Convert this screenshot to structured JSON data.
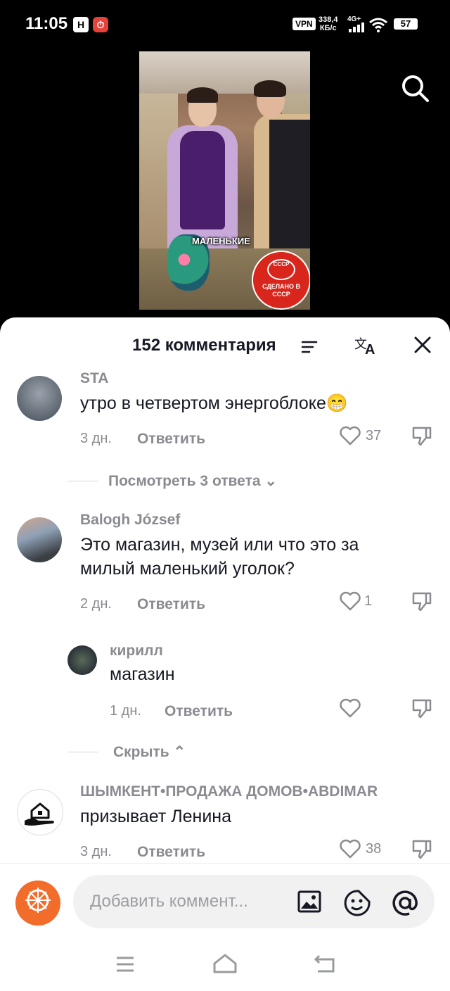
{
  "status": {
    "time": "11:05",
    "icon1": "H",
    "vpn": "VPN",
    "speed_value": "338,4",
    "speed_unit": "КБ/с",
    "network": "4G+",
    "battery": "57"
  },
  "video": {
    "caption": "МАЛЕНЬКИЕ",
    "seal_top": "СССР",
    "seal_text": "СДЕЛАНО В СССР"
  },
  "panel": {
    "title": "152 комментария"
  },
  "comments": [
    {
      "user": "STA",
      "text": "утро в четвертом энергоблоке😁",
      "time": "3 дн.",
      "reply": "Ответить",
      "likes": "37",
      "view_replies": "Посмотреть 3 ответа"
    },
    {
      "user": "Balogh József",
      "text": "Это магазин, музей или что это за милый маленький уголок?",
      "time": "2 дн.",
      "reply": "Ответить",
      "likes": "1"
    },
    {
      "user": "кирилл",
      "text": "магазин",
      "time": "1 дн.",
      "reply": "Ответить",
      "likes": "",
      "hide": "Скрыть"
    },
    {
      "user": "ШЫМКЕНТ•ПРОДАЖА ДОМОВ•ABDIMAR",
      "text": "призывает Ленина",
      "time": "3 дн.",
      "reply": "Ответить",
      "likes": "38"
    }
  ],
  "footer": {
    "placeholder": "Добавить коммент..."
  },
  "colors": {
    "accent": "#f26c2a",
    "muted": "#8a8b91",
    "text": "#161823"
  }
}
